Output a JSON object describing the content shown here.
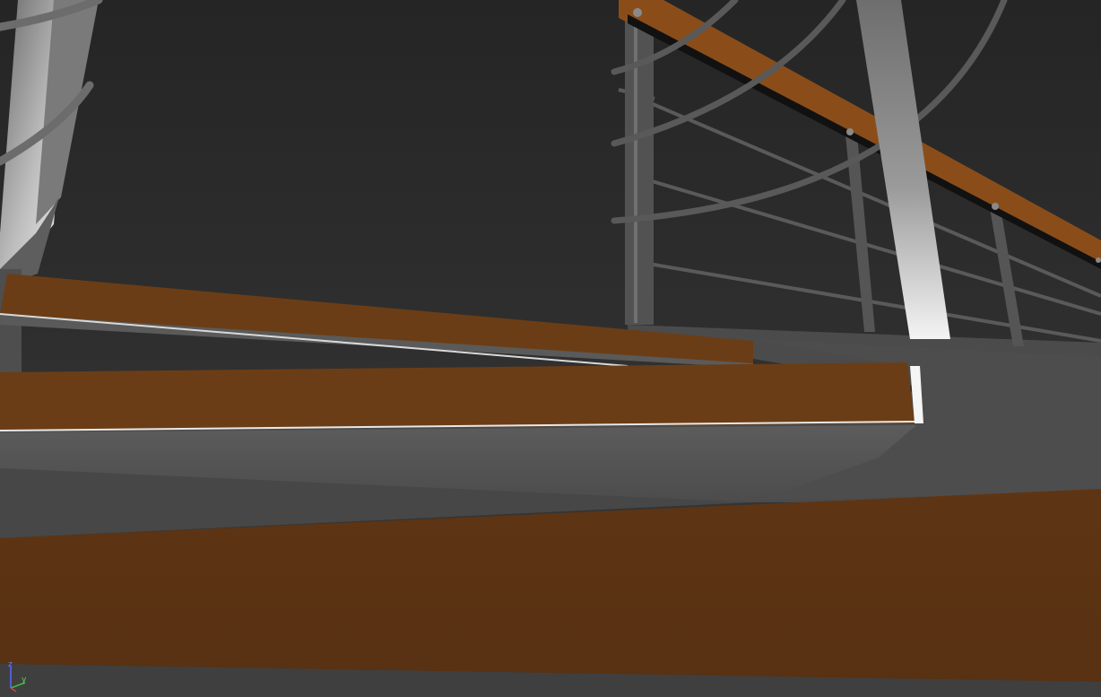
{
  "viewport": {
    "axis_gizmo": {
      "z_label": "z",
      "y_label": "y",
      "colors": {
        "z": "#5a6cff",
        "y": "#3fbf3f",
        "x": "#cc4444"
      }
    },
    "scene": {
      "wood_color": "#6b3d16",
      "wood_dark_color": "#5a3513",
      "steel_color": "#5a5a5a",
      "handrail_color": "#8a4d1a",
      "background_color": "#2b2b2b"
    }
  }
}
